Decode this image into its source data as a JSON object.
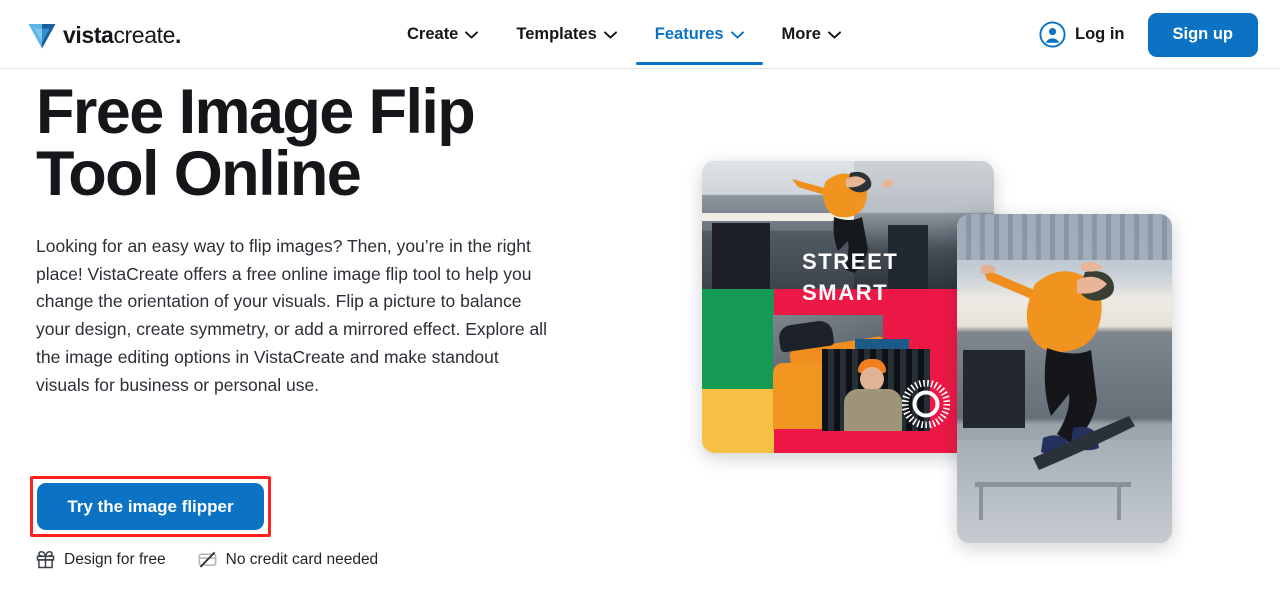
{
  "brand": {
    "logo_icon": "vistacreate-v-logo-icon",
    "name_bold": "vista",
    "name_light": "create",
    "name_dot": ".",
    "logo_color_light": "#5cb4e4",
    "logo_color_dark": "#1b5e9b"
  },
  "nav": {
    "items": [
      {
        "label": "Create",
        "active": false,
        "icon": "chevron-down-icon"
      },
      {
        "label": "Templates",
        "active": false,
        "icon": "chevron-down-icon"
      },
      {
        "label": "Features",
        "active": true,
        "icon": "chevron-down-icon"
      },
      {
        "label": "More",
        "active": false,
        "icon": "chevron-down-icon"
      }
    ],
    "active_color": "#0b72c4"
  },
  "auth": {
    "login_label": "Log in",
    "login_icon": "user-avatar-icon",
    "signup_label": "Sign up",
    "signup_color": "#0b72c4"
  },
  "hero": {
    "title": "Free Image Flip Tool Online",
    "description": "Looking for an easy way to flip images? Then, you’re in the right place! VistaCreate offers a free online image flip tool to help you change the orientation of your visuals. Flip a picture to balance your design, create symmetry, or add a mirrored effect. Explore all the image editing options in VistaCreate and make standout visuals for business or personal use.",
    "cta_label": "Try the image flipper",
    "cta_color": "#0b72c4",
    "annotation_color": "#ff1f1f",
    "perks": [
      {
        "label": "Design for free",
        "icon": "gift-icon"
      },
      {
        "label": "No credit card needed",
        "icon": "no-credit-card-icon"
      }
    ]
  },
  "artwork": {
    "collage_card": {
      "name": "street-smart-collage-image",
      "headline_line1": "STREET",
      "headline_line2": "SMART",
      "colors": {
        "green": "#149a54",
        "yellow": "#f5c043",
        "red": "#ed1846"
      }
    },
    "skater_card": {
      "name": "skateboarder-photo-image"
    }
  }
}
